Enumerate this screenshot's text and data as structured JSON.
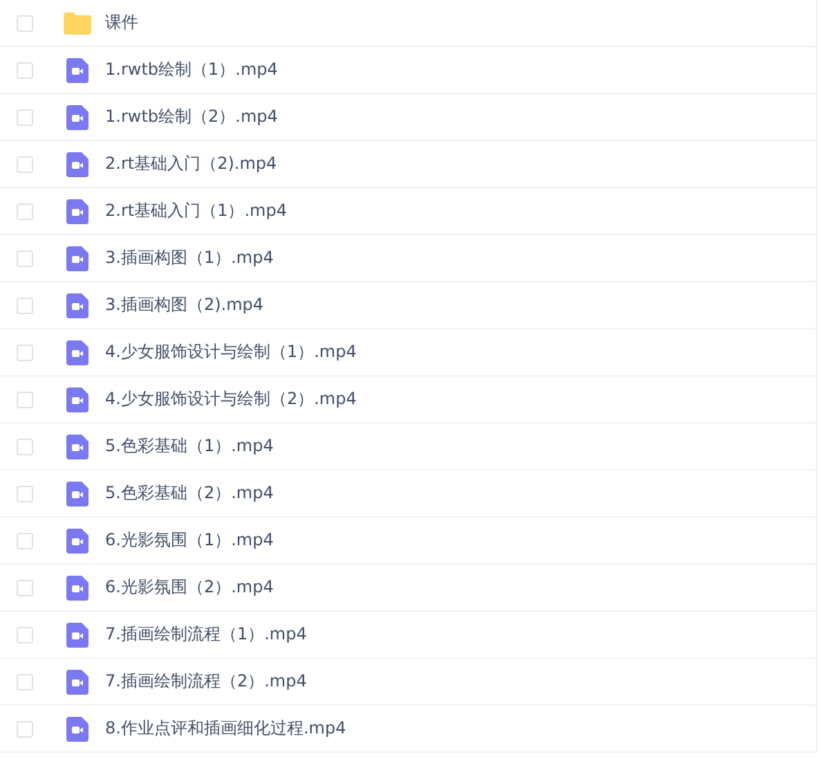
{
  "files": [
    {
      "kind": "folder",
      "name": "课件",
      "checked": false
    },
    {
      "kind": "video",
      "name": "1.rwtb绘制（1）.mp4",
      "checked": false
    },
    {
      "kind": "video",
      "name": "1.rwtb绘制（2）.mp4",
      "checked": false
    },
    {
      "kind": "video",
      "name": "2.rt基础入门（2).mp4",
      "checked": false
    },
    {
      "kind": "video",
      "name": "2.rt基础入门（1）.mp4",
      "checked": false
    },
    {
      "kind": "video",
      "name": "3.插画构图（1）.mp4",
      "checked": false
    },
    {
      "kind": "video",
      "name": "3.插画构图（2).mp4",
      "checked": false
    },
    {
      "kind": "video",
      "name": "4.少女服饰设计与绘制（1）.mp4",
      "checked": false
    },
    {
      "kind": "video",
      "name": "4.少女服饰设计与绘制（2）.mp4",
      "checked": false
    },
    {
      "kind": "video",
      "name": "5.色彩基础（1）.mp4",
      "checked": false
    },
    {
      "kind": "video",
      "name": "5.色彩基础（2）.mp4",
      "checked": false
    },
    {
      "kind": "video",
      "name": "6.光影氛围（1）.mp4",
      "checked": false
    },
    {
      "kind": "video",
      "name": "6.光影氛围（2）.mp4",
      "checked": false
    },
    {
      "kind": "video",
      "name": "7.插画绘制流程（1）.mp4",
      "checked": false
    },
    {
      "kind": "video",
      "name": "7.插画绘制流程（2）.mp4",
      "checked": false
    },
    {
      "kind": "video",
      "name": "8.作业点评和插画细化过程.mp4",
      "checked": false
    }
  ]
}
